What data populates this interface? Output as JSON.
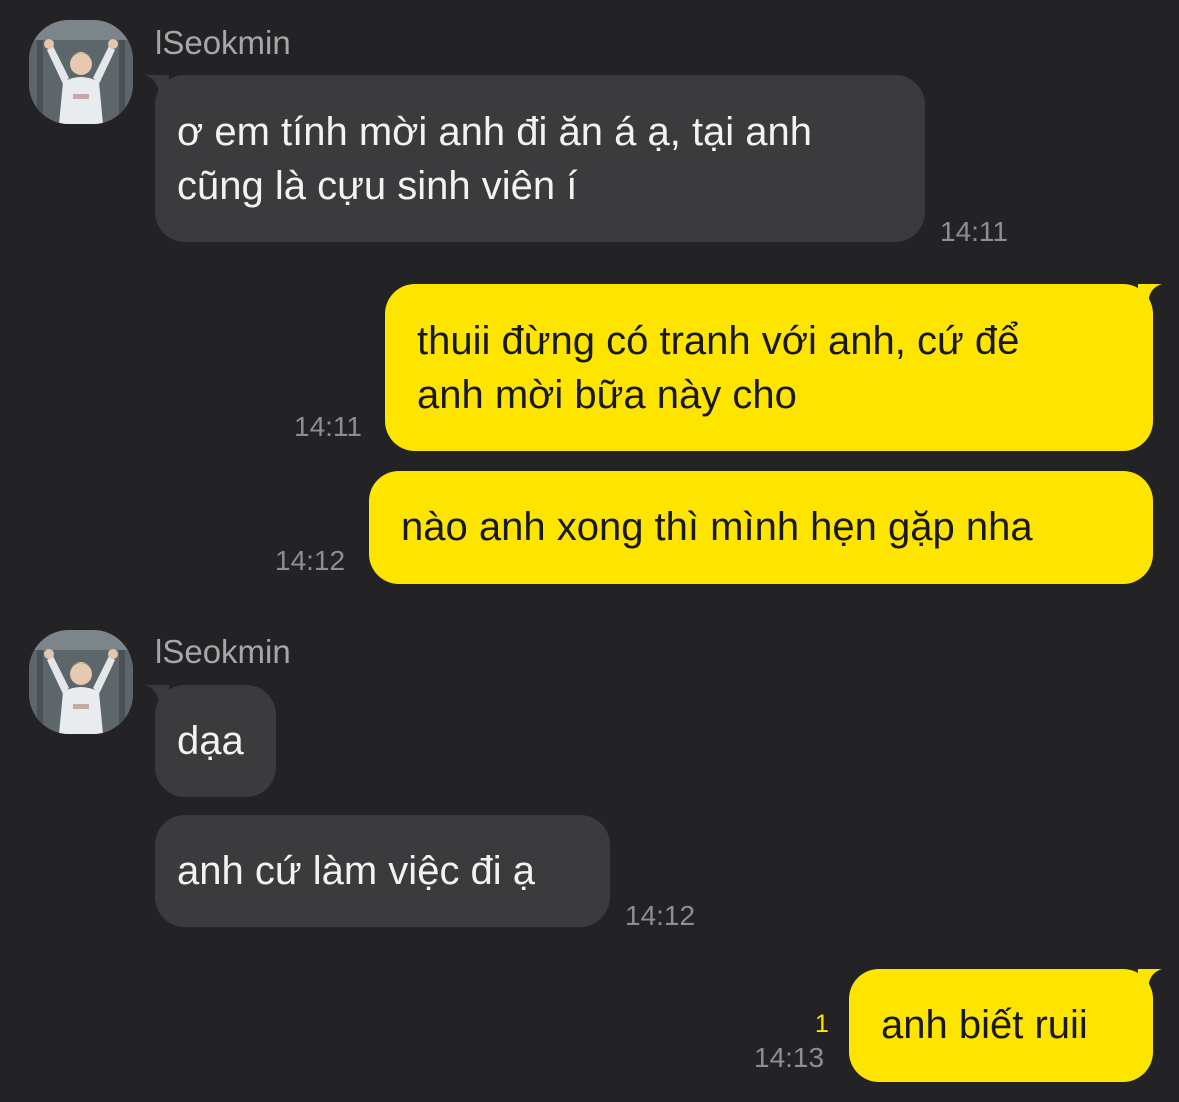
{
  "chat": {
    "sender_name": "lSeokmin",
    "messages": [
      {
        "direction": "incoming",
        "lines": [
          "ơ em tính mời anh đi ăn á ạ, tại anh",
          "cũng là cựu sinh viên í"
        ],
        "time": "14:11"
      },
      {
        "direction": "outgoing",
        "lines": [
          "thuii đừng có tranh với anh, cứ để",
          "anh mời bữa này cho"
        ],
        "time": "14:11"
      },
      {
        "direction": "outgoing",
        "lines": [
          "nào anh xong thì mình hẹn gặp nha"
        ],
        "time": "14:12"
      },
      {
        "direction": "incoming",
        "lines": [
          "dạa"
        ]
      },
      {
        "direction": "incoming",
        "lines": [
          "anh cứ làm việc đi ạ"
        ],
        "time": "14:12"
      },
      {
        "direction": "outgoing",
        "lines": [
          "anh biết ruii"
        ],
        "time": "14:13",
        "unread_count": "1"
      }
    ]
  },
  "colors": {
    "background": "#232325",
    "incoming_bubble": "#3b3b3e",
    "outgoing_bubble": "#fee500",
    "unread_indicator": "#fee500"
  },
  "icons": {
    "avatar": "profile-photo"
  }
}
